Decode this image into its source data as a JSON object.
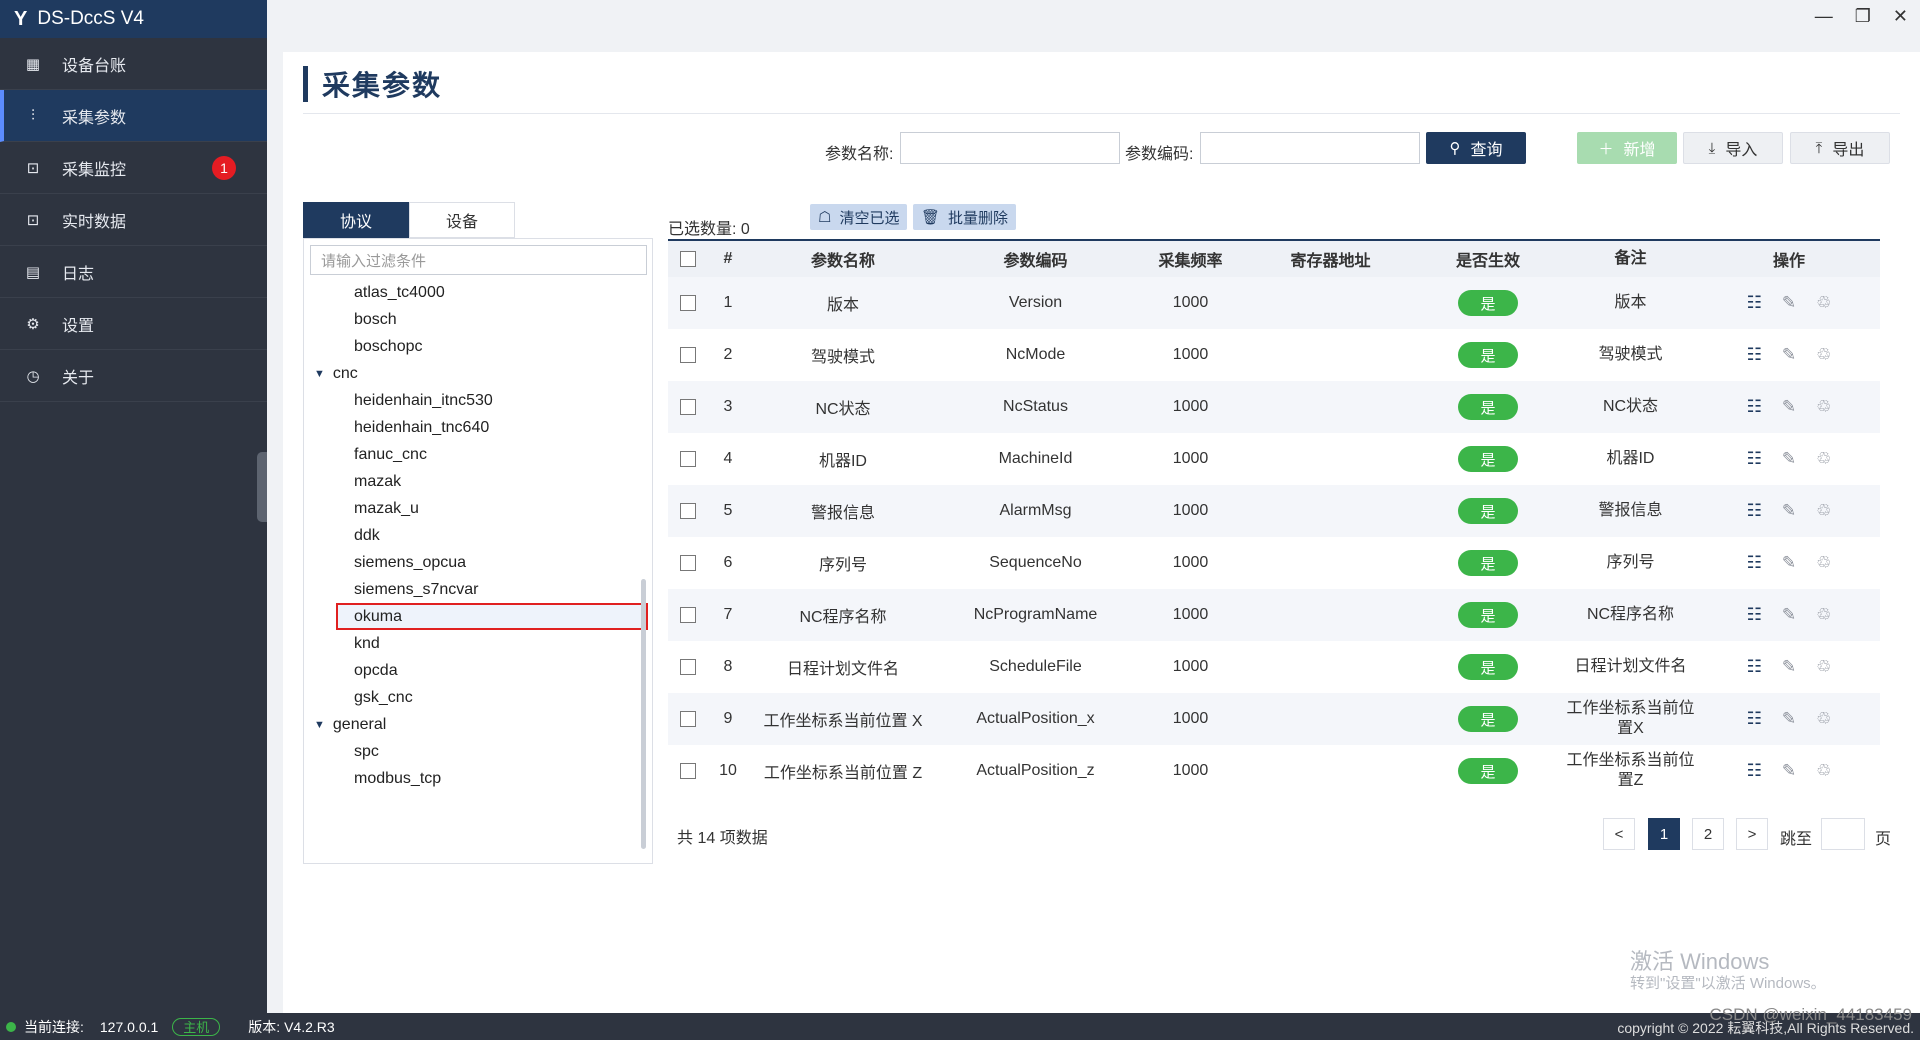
{
  "app": {
    "title": "DS-DccS V4",
    "logo": "Y"
  },
  "window_controls": [
    "minimize-icon",
    "restore-icon",
    "close-icon"
  ],
  "sidebar": {
    "items": [
      {
        "label": "设备台账",
        "icon": "ledger-icon",
        "glyph": "▦"
      },
      {
        "label": "采集参数",
        "icon": "sliders-icon",
        "glyph": "⫶",
        "active": true
      },
      {
        "label": "采集监控",
        "icon": "monitor-icon",
        "glyph": "⊡",
        "badge": "1"
      },
      {
        "label": "实时数据",
        "icon": "chart-icon",
        "glyph": "⊡"
      },
      {
        "label": "日志",
        "icon": "calendar-icon",
        "glyph": "▤"
      },
      {
        "label": "设置",
        "icon": "gear-icon",
        "glyph": "⚙"
      },
      {
        "label": "关于",
        "icon": "info-icon",
        "glyph": "◷"
      }
    ]
  },
  "page": {
    "title": "采集参数"
  },
  "search": {
    "name_label": "参数名称:",
    "name_value": "",
    "code_label": "参数编码:",
    "code_value": "",
    "query_label": "查询",
    "add_label": "新增",
    "import_label": "导入",
    "export_label": "导出"
  },
  "left_tabs": {
    "protocol": "协议",
    "device": "设备"
  },
  "tree": {
    "filter_placeholder": "请输入过滤条件",
    "rows": [
      {
        "label": "atlas_tc4000",
        "type": "leaf"
      },
      {
        "label": "bosch",
        "type": "leaf"
      },
      {
        "label": "boschopc",
        "type": "leaf"
      },
      {
        "label": "cnc",
        "type": "group"
      },
      {
        "label": "heidenhain_itnc530",
        "type": "leaf"
      },
      {
        "label": "heidenhain_tnc640",
        "type": "leaf"
      },
      {
        "label": "fanuc_cnc",
        "type": "leaf"
      },
      {
        "label": "mazak",
        "type": "leaf"
      },
      {
        "label": "mazak_u",
        "type": "leaf"
      },
      {
        "label": "ddk",
        "type": "leaf"
      },
      {
        "label": "siemens_opcua",
        "type": "leaf"
      },
      {
        "label": "siemens_s7ncvar",
        "type": "leaf"
      },
      {
        "label": "okuma",
        "type": "leaf",
        "selected": true
      },
      {
        "label": "knd",
        "type": "leaf"
      },
      {
        "label": "opcda",
        "type": "leaf"
      },
      {
        "label": "gsk_cnc",
        "type": "leaf"
      },
      {
        "label": "general",
        "type": "group"
      },
      {
        "label": "spc",
        "type": "leaf"
      },
      {
        "label": "modbus_tcp",
        "type": "leaf"
      }
    ]
  },
  "toolbar": {
    "selected_text": "已选数量: 0",
    "clear_label": "清空已选",
    "batch_delete_label": "批量删除"
  },
  "table": {
    "headers": [
      "#",
      "参数名称",
      "参数编码",
      "采集频率",
      "寄存器地址",
      "是否生效",
      "备注",
      "操作"
    ],
    "rows": [
      {
        "num": "1",
        "name": "版本",
        "code": "Version",
        "freq": "1000",
        "reg": "",
        "effective": "是",
        "note": "版本"
      },
      {
        "num": "2",
        "name": "驾驶模式",
        "code": "NcMode",
        "freq": "1000",
        "reg": "",
        "effective": "是",
        "note": "驾驶模式"
      },
      {
        "num": "3",
        "name": "NC状态",
        "code": "NcStatus",
        "freq": "1000",
        "reg": "",
        "effective": "是",
        "note": "NC状态"
      },
      {
        "num": "4",
        "name": "机器ID",
        "code": "MachineId",
        "freq": "1000",
        "reg": "",
        "effective": "是",
        "note": "机器ID"
      },
      {
        "num": "5",
        "name": "警报信息",
        "code": "AlarmMsg",
        "freq": "1000",
        "reg": "",
        "effective": "是",
        "note": "警报信息"
      },
      {
        "num": "6",
        "name": "序列号",
        "code": "SequenceNo",
        "freq": "1000",
        "reg": "",
        "effective": "是",
        "note": "序列号"
      },
      {
        "num": "7",
        "name": "NC程序名称",
        "code": "NcProgramName",
        "freq": "1000",
        "reg": "",
        "effective": "是",
        "note": "NC程序名称"
      },
      {
        "num": "8",
        "name": "日程计划文件名",
        "code": "ScheduleFile",
        "freq": "1000",
        "reg": "",
        "effective": "是",
        "note": "日程计划文件名"
      },
      {
        "num": "9",
        "name": "工作坐标系当前位置  X",
        "code": "ActualPosition_x",
        "freq": "1000",
        "reg": "",
        "effective": "是",
        "note": "工作坐标系当前位置X"
      },
      {
        "num": "10",
        "name": "工作坐标系当前位置 Z",
        "code": "ActualPosition_z",
        "freq": "1000",
        "reg": "",
        "effective": "是",
        "note": "工作坐标系当前位置Z"
      }
    ]
  },
  "pagination": {
    "total_text": "共 14 项数据",
    "prev": "<",
    "pages": [
      "1",
      "2"
    ],
    "current": "1",
    "next": ">",
    "jump_label": "跳至",
    "page_suffix": "页",
    "jump_value": ""
  },
  "watermark": {
    "line1": "激活 Windows",
    "line2": "转到\"设置\"以激活 Windows。"
  },
  "status_bar": {
    "connection_label": "当前连接:",
    "connection_value": "127.0.0.1",
    "host_badge": "主机",
    "version_text": "版本: V4.2.R3",
    "copyright": "copyright © 2022 耘翼科技,All Rights Reserved.",
    "csdn": "CSDN @weixin_44183459"
  }
}
